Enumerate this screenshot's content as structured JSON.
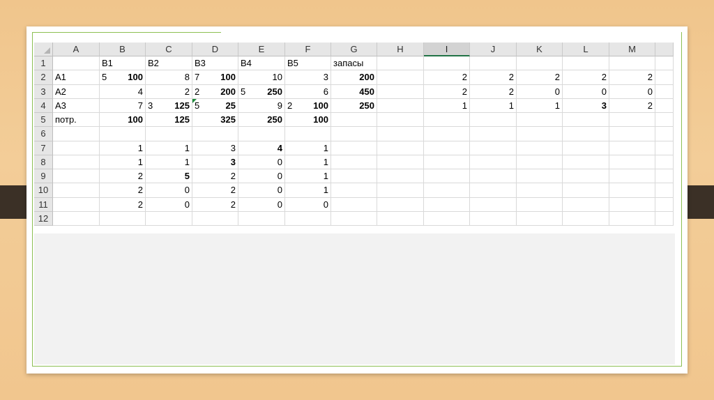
{
  "columns": [
    "A",
    "B",
    "C",
    "D",
    "E",
    "F",
    "G",
    "H",
    "I",
    "J",
    "K",
    "L",
    "M"
  ],
  "selected_column": "I",
  "rows": [
    {
      "num": "1",
      "A": "",
      "B": {
        "left": "B1",
        "right": ""
      },
      "C": {
        "left": "B2",
        "right": ""
      },
      "D": {
        "left": "B3",
        "right": ""
      },
      "E": {
        "left": "B4",
        "right": ""
      },
      "F": {
        "left": "B5",
        "right": ""
      },
      "G": "запасы",
      "H": "",
      "I": "",
      "J": "",
      "K": "",
      "L": "",
      "M": ""
    },
    {
      "num": "2",
      "A": "A1",
      "B": {
        "left": "5",
        "right": "100"
      },
      "C": {
        "left": "",
        "right": "8"
      },
      "D": {
        "left": "7",
        "right": "100"
      },
      "E": {
        "left": "",
        "right": "10"
      },
      "F": {
        "left": "",
        "right": "3"
      },
      "G": "200",
      "H": "",
      "I": "2",
      "J": "2",
      "K": "2",
      "L": "2",
      "M": "2"
    },
    {
      "num": "3",
      "A": "A2",
      "B": {
        "left": "",
        "right": "4"
      },
      "C": {
        "left": "",
        "right": "2"
      },
      "D": {
        "left": "2",
        "right": "200"
      },
      "E": {
        "left": "5",
        "right": "250"
      },
      "F": {
        "left": "",
        "right": "6"
      },
      "G": "450",
      "H": "",
      "I": "2",
      "J": "2",
      "K": "0",
      "L": "0",
      "M": "0"
    },
    {
      "num": "4",
      "A": "A3",
      "B": {
        "left": "",
        "right": "7"
      },
      "C": {
        "left": "3",
        "right": "125"
      },
      "D": {
        "left": "5",
        "right": "25"
      },
      "E": {
        "left": "",
        "right": "9"
      },
      "F": {
        "left": "2",
        "right": "100"
      },
      "G": "250",
      "H": "",
      "I": "1",
      "J": "1",
      "K": "1",
      "L": "3",
      "M": "2"
    },
    {
      "num": "5",
      "A": "потр.",
      "B": {
        "left": "",
        "right": "100"
      },
      "C": {
        "left": "",
        "right": "125"
      },
      "D": {
        "left": "",
        "right": "325"
      },
      "E": {
        "left": "",
        "right": "250"
      },
      "F": {
        "left": "",
        "right": "100"
      },
      "G": "",
      "H": "",
      "I": "",
      "J": "",
      "K": "",
      "L": "",
      "M": ""
    },
    {
      "num": "6",
      "A": "",
      "B": "",
      "C": "",
      "D": "",
      "E": "",
      "F": "",
      "G": "",
      "H": "",
      "I": "",
      "J": "",
      "K": "",
      "L": "",
      "M": ""
    },
    {
      "num": "7",
      "A": "",
      "B": "1",
      "C": "1",
      "D": "3",
      "E": "4",
      "F": "1",
      "G": "",
      "H": "",
      "I": "",
      "J": "",
      "K": "",
      "L": "",
      "M": ""
    },
    {
      "num": "8",
      "A": "",
      "B": "1",
      "C": "1",
      "D": "3",
      "E": "0",
      "F": "1",
      "G": "",
      "H": "",
      "I": "",
      "J": "",
      "K": "",
      "L": "",
      "M": ""
    },
    {
      "num": "9",
      "A": "",
      "B": "2",
      "C": "5",
      "D": "2",
      "E": "0",
      "F": "1",
      "G": "",
      "H": "",
      "I": "",
      "J": "",
      "K": "",
      "L": "",
      "M": ""
    },
    {
      "num": "10",
      "A": "",
      "B": "2",
      "C": "0",
      "D": "2",
      "E": "0",
      "F": "1",
      "G": "",
      "H": "",
      "I": "",
      "J": "",
      "K": "",
      "L": "",
      "M": ""
    },
    {
      "num": "11",
      "A": "",
      "B": "2",
      "C": "0",
      "D": "2",
      "E": "0",
      "F": "0",
      "G": "",
      "H": "",
      "I": "",
      "J": "",
      "K": "",
      "L": "",
      "M": ""
    },
    {
      "num": "12",
      "A": "",
      "B": "",
      "C": "",
      "D": "",
      "E": "",
      "F": "",
      "G": "",
      "H": "",
      "I": "",
      "J": "",
      "K": "",
      "L": "",
      "M": ""
    }
  ],
  "bold_cells": [
    "B2",
    "D2",
    "G2",
    "E3",
    "D3",
    "G3",
    "C4",
    "D4",
    "F4",
    "G4",
    "L4",
    "B5",
    "C5",
    "D5",
    "E5",
    "F5",
    "E7",
    "D8",
    "C9"
  ],
  "colors": {
    "accent": "#217346",
    "frame": "#8cbf52",
    "comment": "#1e8a3a"
  }
}
